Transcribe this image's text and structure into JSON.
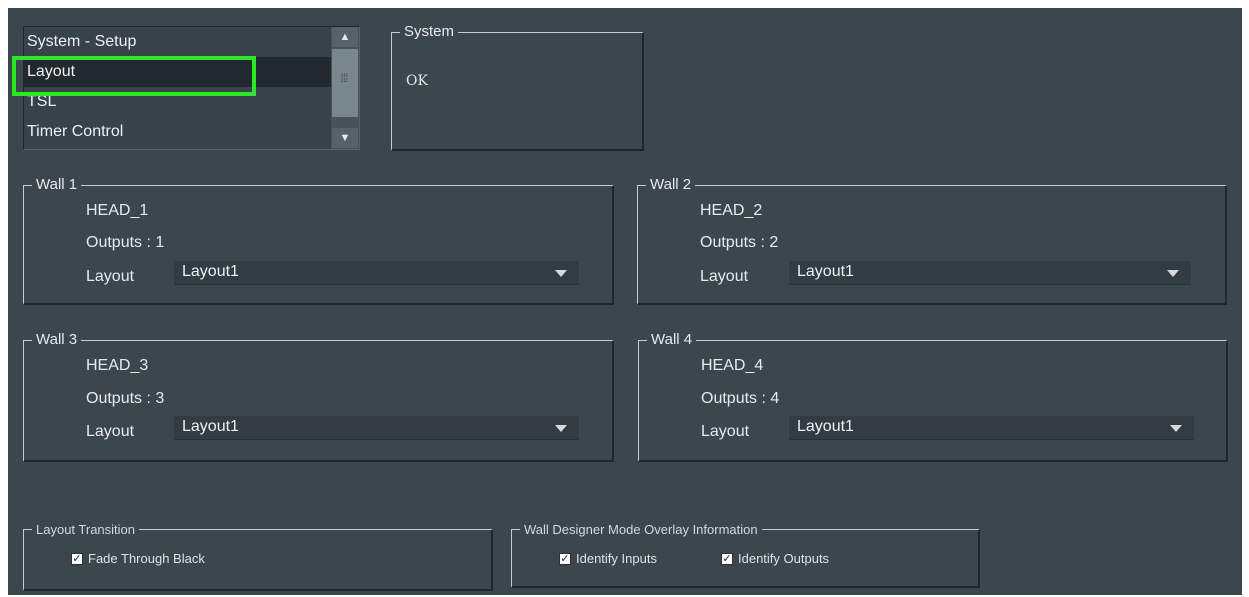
{
  "menu": {
    "items": [
      "System - Setup",
      "Layout",
      "TSL",
      "Timer Control"
    ],
    "selected": "Layout"
  },
  "system": {
    "title": "System",
    "status": "OK"
  },
  "walls": [
    {
      "title": "Wall 1",
      "head": "HEAD_1",
      "outputs": "Outputs : 1",
      "layout_label": "Layout",
      "layout_value": "Layout1"
    },
    {
      "title": "Wall 2",
      "head": "HEAD_2",
      "outputs": "Outputs : 2",
      "layout_label": "Layout",
      "layout_value": "Layout1"
    },
    {
      "title": "Wall 3",
      "head": "HEAD_3",
      "outputs": "Outputs : 3",
      "layout_label": "Layout",
      "layout_value": "Layout1"
    },
    {
      "title": "Wall 4",
      "head": "HEAD_4",
      "outputs": "Outputs : 4",
      "layout_label": "Layout",
      "layout_value": "Layout1"
    }
  ],
  "transition": {
    "title": "Layout Transition",
    "fade_label": "Fade Through Black",
    "fade_checked": true
  },
  "overlay": {
    "title": "Wall Designer Mode Overlay Information",
    "inputs_label": "Identify Inputs",
    "inputs_checked": true,
    "outputs_label": "Identify Outputs",
    "outputs_checked": true
  },
  "colors": {
    "background": "#3c464d",
    "highlight": "#2ee52a",
    "selected_row": "#222a30"
  }
}
